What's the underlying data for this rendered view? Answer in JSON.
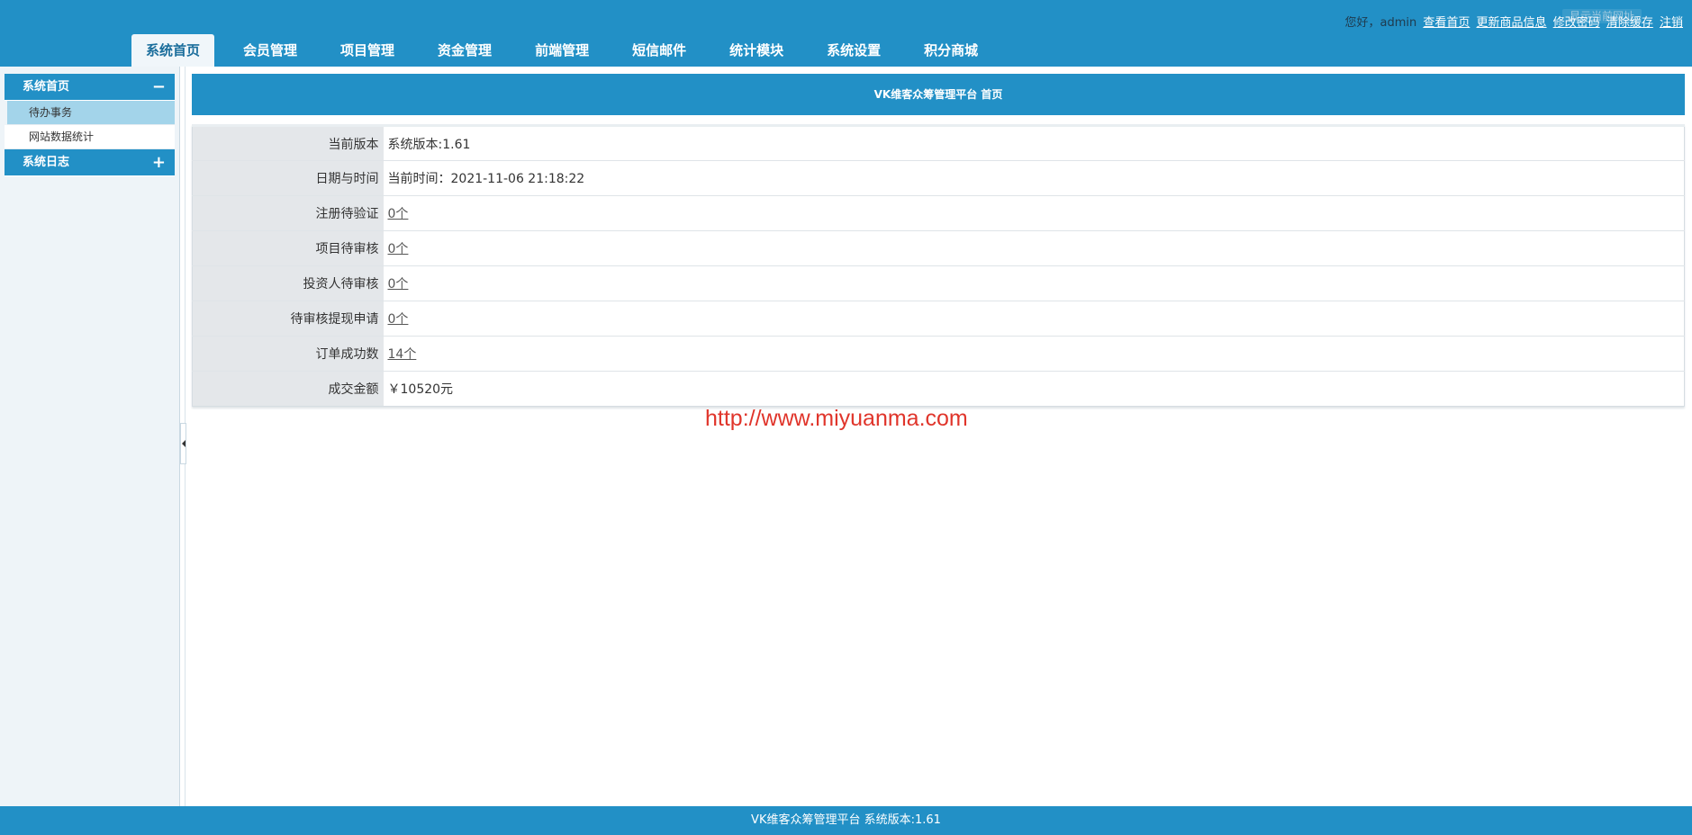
{
  "header": {
    "greeting": "您好，admin",
    "links": [
      "查看首页",
      "更新商品信息",
      "修改密码",
      "清除缓存",
      "注销"
    ],
    "faded_button": "显示当前网址"
  },
  "nav": {
    "tabs": [
      "系统首页",
      "会员管理",
      "项目管理",
      "资金管理",
      "前端管理",
      "短信邮件",
      "统计模块",
      "系统设置",
      "积分商城"
    ],
    "active_tab": "系统首页"
  },
  "sidebar": {
    "groups": [
      {
        "title": "系统首页",
        "toggle": "−",
        "items": [
          "待办事务",
          "网站数据统计"
        ]
      },
      {
        "title": "系统日志",
        "toggle": "+"
      }
    ]
  },
  "main": {
    "title": "VK维客众筹管理平台 首页",
    "rows": [
      {
        "label": "当前版本",
        "value": "系统版本:1.61"
      },
      {
        "label": "日期与时间",
        "value": "当前时间：2021-11-06 21:18:22"
      },
      {
        "label": "注册待验证",
        "value": "0个"
      },
      {
        "label": "项目待审核",
        "value": "0个"
      },
      {
        "label": "投资人待审核",
        "value": "0个"
      },
      {
        "label": "待审核提现申请",
        "value": "0个"
      },
      {
        "label": "订单成功数",
        "value": "14个"
      },
      {
        "label": "成交金额",
        "value": "￥10520元"
      }
    ]
  },
  "watermark": "http://www.miyuanma.com",
  "footer": {
    "text": "VK维客众筹管理平台 系统版本:1.61"
  },
  "colors": {
    "primary": "#2290c6",
    "sidebar_bg": "#eef4f8",
    "active_item": "#a3d4ea",
    "label_bg": "#e4e7ea",
    "watermark": "#e0352b"
  }
}
